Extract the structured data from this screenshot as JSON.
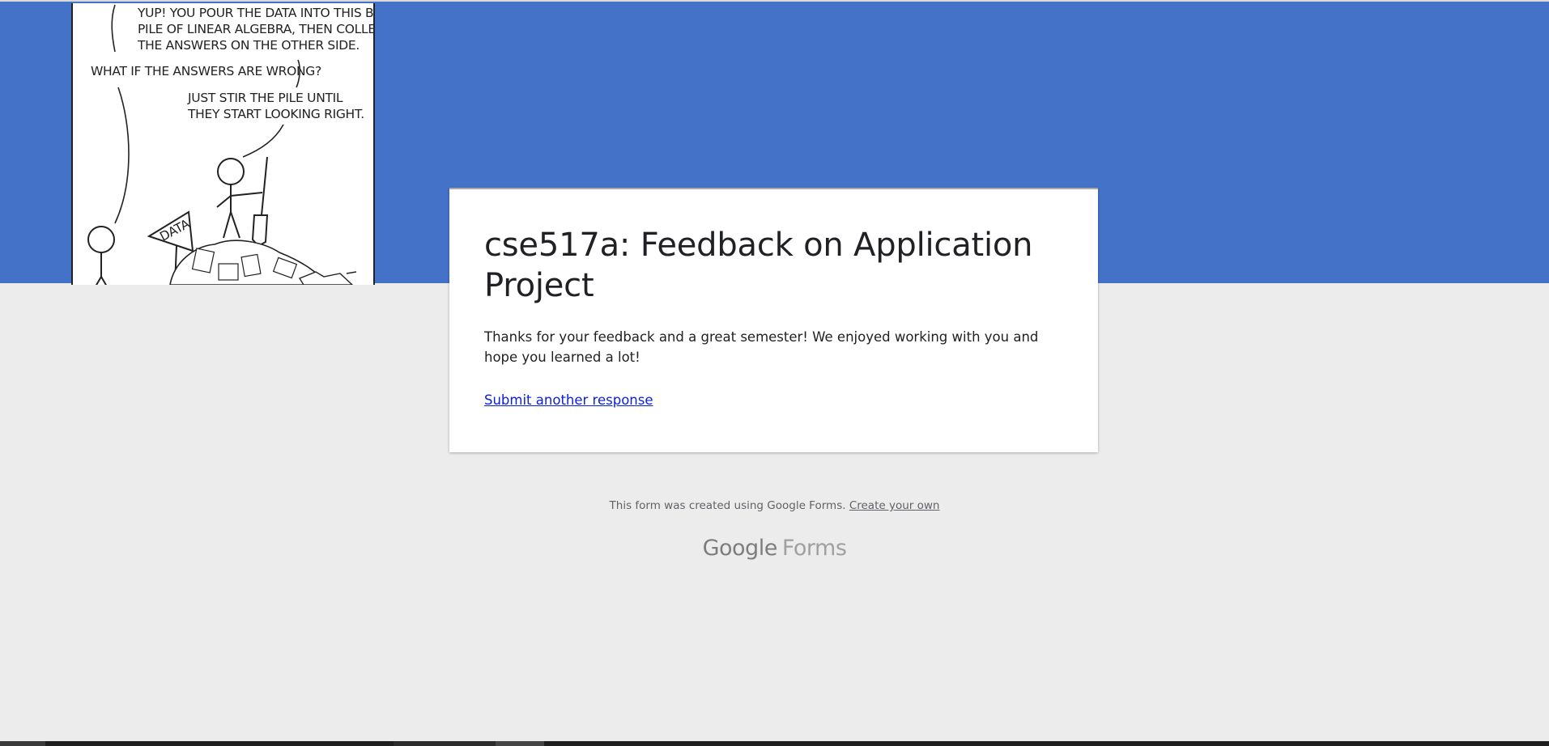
{
  "colors": {
    "header_band": "#4472c9",
    "page_background": "#ececec",
    "card_background": "#ffffff",
    "link": "#0b1fd6"
  },
  "header": {
    "comic": {
      "lines": [
        "YUP!  YOU POUR THE DATA INTO THIS BIG",
        "PILE OF LINEAR ALGEBRA, THEN COLLECT",
        "THE ANSWERS ON THE OTHER SIDE.",
        "WHAT IF THE ANSWERS ARE WRONG?",
        "JUST STIR THE PILE UNTIL",
        "THEY START LOOKING RIGHT."
      ],
      "funnel_label": "DATA"
    }
  },
  "card": {
    "title": "cse517a: Feedback on Application Project",
    "message": "Thanks for your feedback and a great semester! We enjoyed working with you and hope you learned a lot!",
    "link_label": "Submit another response"
  },
  "footer": {
    "text": "This form was created using Google Forms.",
    "link_label": "Create your own"
  },
  "brand": {
    "google": "Google",
    "forms": "Forms"
  }
}
